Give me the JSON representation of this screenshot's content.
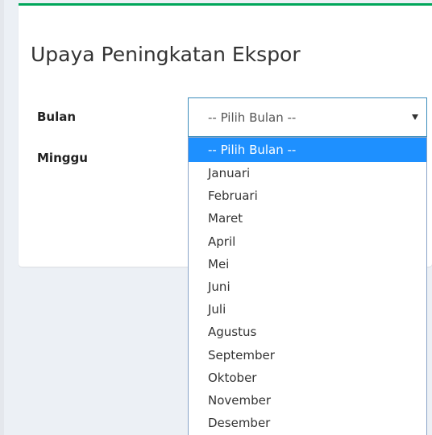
{
  "page": {
    "title": "Upaya Peningkatan Ekspor"
  },
  "form": {
    "bulan_label": "Bulan",
    "minggu_label": "Minggu",
    "bulan_select": {
      "value": "-- Pilih Bulan --",
      "caret_icon": "triangle-down",
      "expanded": true,
      "options": [
        "-- Pilih Bulan --",
        "Januari",
        "Februari",
        "Maret",
        "April",
        "Mei",
        "Juni",
        "Juli",
        "Agustus",
        "September",
        "Oktober",
        "November",
        "Desember"
      ],
      "highlighted_option": "-- Pilih Bulan --"
    }
  },
  "colors": {
    "accent_border": "#00a65a",
    "select_focus_border": "#3c8dbc",
    "option_highlight": "#1e90ff",
    "page_background": "#ecf0f5"
  }
}
